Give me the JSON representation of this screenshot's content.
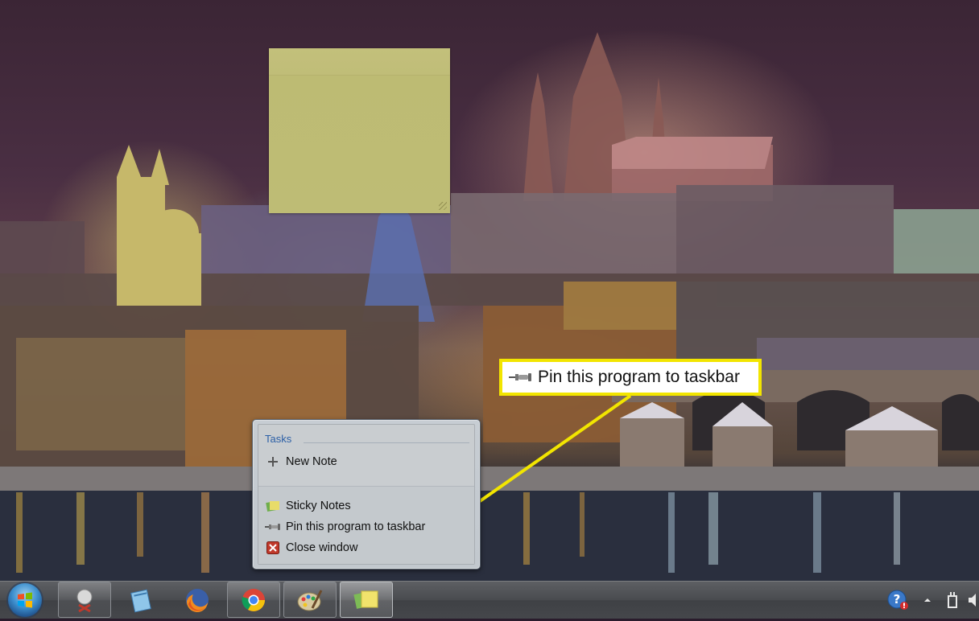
{
  "jumplist": {
    "section_title": "Tasks",
    "items": [
      {
        "label": "New Note",
        "icon": "plus-icon"
      },
      {
        "label": "Sticky Notes",
        "icon": "sticky-notes-icon"
      },
      {
        "label": "Pin this program to taskbar",
        "icon": "pin-icon"
      },
      {
        "label": "Close window",
        "icon": "close-window-icon"
      }
    ]
  },
  "callout": {
    "text": "Pin this program to taskbar",
    "icon": "pin-icon",
    "highlight_color": "#f2e500"
  },
  "taskbar": {
    "start": "windows-start-orb",
    "buttons": [
      {
        "name": "snipping-tool",
        "icon": "snipping-tool-icon"
      },
      {
        "name": "notepad",
        "icon": "notepad-icon"
      },
      {
        "name": "firefox",
        "icon": "firefox-icon"
      },
      {
        "name": "chrome",
        "icon": "chrome-icon"
      },
      {
        "name": "paint",
        "icon": "paint-icon"
      },
      {
        "name": "sticky-notes",
        "icon": "sticky-notes-icon",
        "active": true
      }
    ],
    "tray": [
      "help-icon",
      "show-hidden-icons-chevron",
      "power-icon",
      "volume-icon"
    ]
  }
}
